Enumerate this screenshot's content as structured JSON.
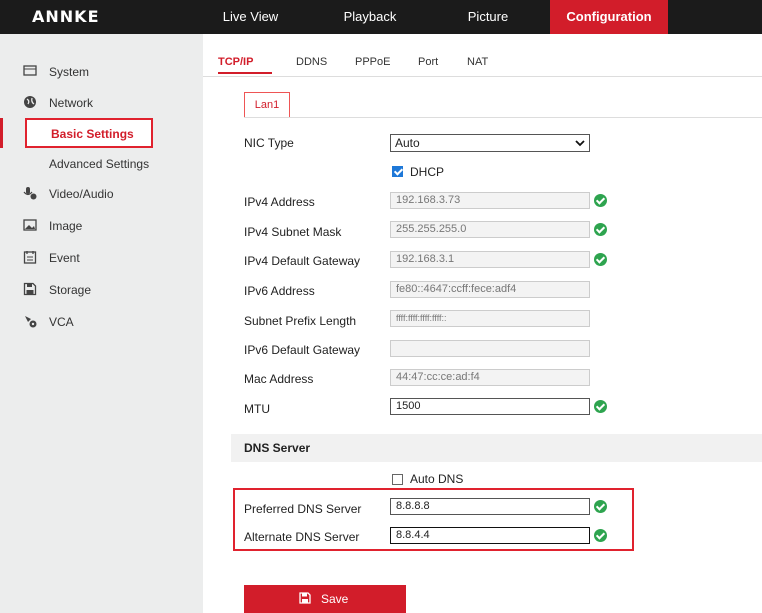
{
  "brand": "ANNKE",
  "nav": {
    "items": [
      {
        "label": "Live View",
        "active": false
      },
      {
        "label": "Playback",
        "active": false
      },
      {
        "label": "Picture",
        "active": false
      },
      {
        "label": "Configuration",
        "active": true
      }
    ]
  },
  "sidebar": {
    "items": [
      {
        "label": "System",
        "icon": "monitor-icon"
      },
      {
        "label": "Network",
        "icon": "globe-icon"
      },
      {
        "label": "Basic Settings",
        "active": true
      },
      {
        "label": "Advanced Settings"
      },
      {
        "label": "Video/Audio",
        "icon": "microphone-camera-icon"
      },
      {
        "label": "Image",
        "icon": "image-icon"
      },
      {
        "label": "Event",
        "icon": "calendar-icon"
      },
      {
        "label": "Storage",
        "icon": "save-disk-icon"
      },
      {
        "label": "VCA",
        "icon": "vca-icon"
      }
    ]
  },
  "tabs": [
    "TCP/IP",
    "DDNS",
    "PPPoE",
    "Port",
    "NAT"
  ],
  "subtab": "Lan1",
  "form": {
    "nic_type": {
      "label": "NIC Type",
      "value": "Auto"
    },
    "dhcp": {
      "label": "DHCP",
      "checked": true
    },
    "ipv4_address": {
      "label": "IPv4 Address",
      "value": "192.168.3.73"
    },
    "ipv4_mask": {
      "label": "IPv4 Subnet Mask",
      "value": "255.255.255.0"
    },
    "ipv4_gateway": {
      "label": "IPv4 Default Gateway",
      "value": "192.168.3.1"
    },
    "ipv6_address": {
      "label": "IPv6 Address",
      "value": "fe80::4647:ccff:fece:adf4"
    },
    "subnet_prefix": {
      "label": "Subnet Prefix Length",
      "value": "ffff:ffff:ffff:ffff::"
    },
    "ipv6_gateway": {
      "label": "IPv6 Default Gateway",
      "value": ""
    },
    "mac": {
      "label": "Mac Address",
      "value": "44:47:cc:ce:ad:f4"
    },
    "mtu": {
      "label": "MTU",
      "value": "1500"
    }
  },
  "dns": {
    "section_title": "DNS Server",
    "auto_dns": {
      "label": "Auto DNS",
      "checked": false
    },
    "preferred": {
      "label": "Preferred DNS Server",
      "value": "8.8.8.8"
    },
    "alternate": {
      "label": "Alternate DNS Server",
      "value": "8.8.4.4"
    }
  },
  "save_label": "Save",
  "colors": {
    "accent": "#d21d2a",
    "topbar": "#1b1b1b",
    "sidebar": "#eceded",
    "ok": "#2ea44f"
  }
}
